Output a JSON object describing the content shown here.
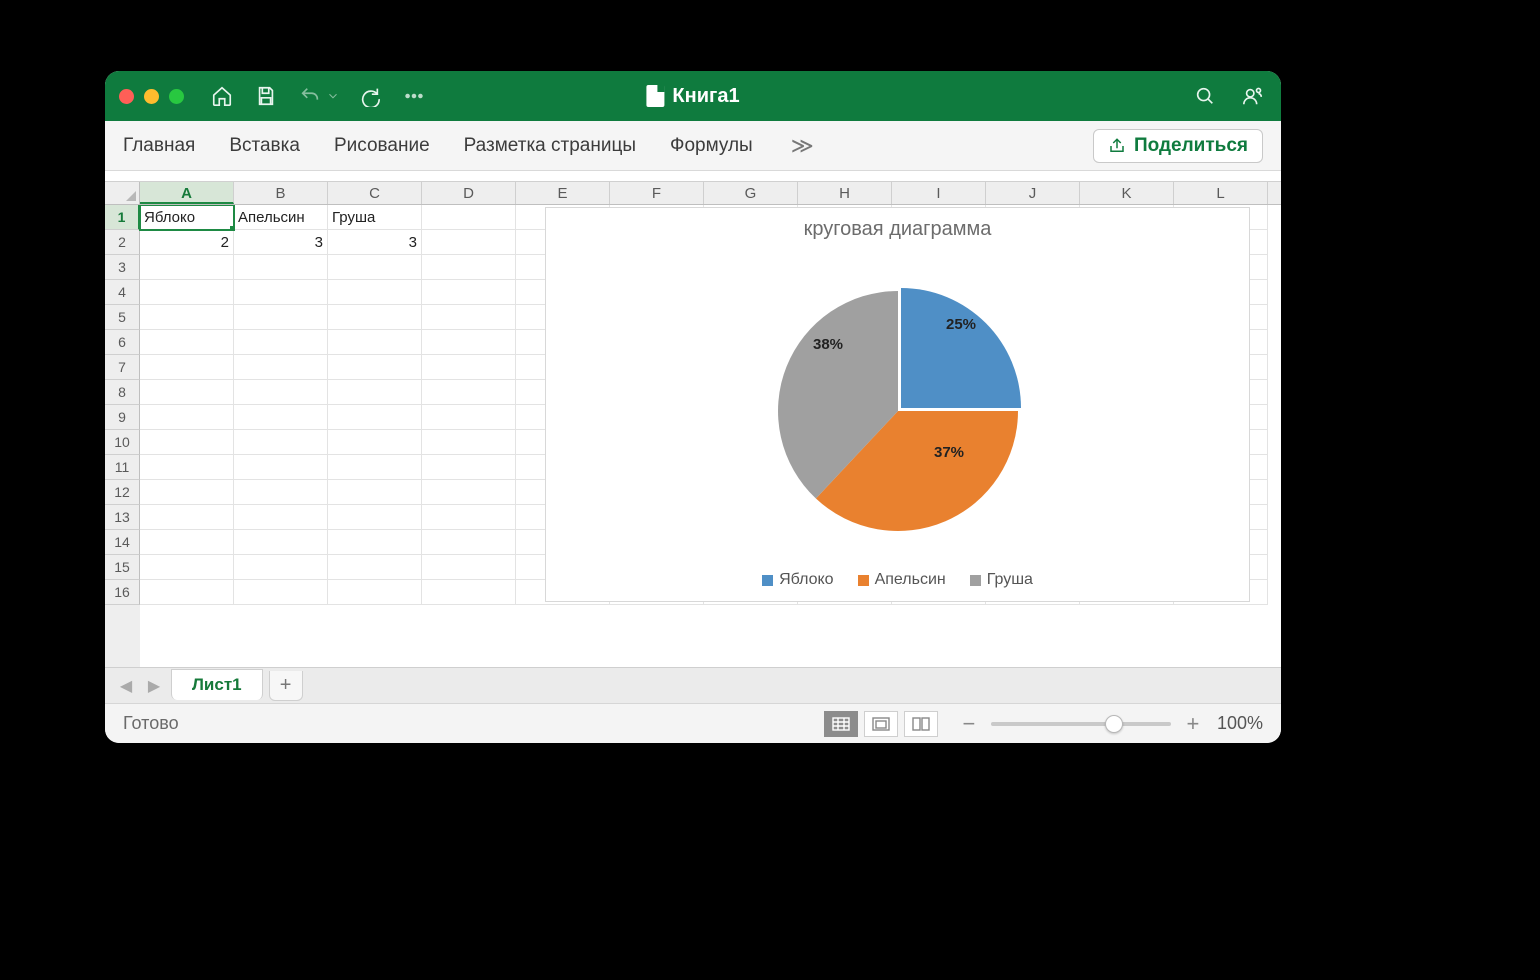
{
  "titlebar": {
    "doc_name": "Книга1"
  },
  "ribbon": {
    "tabs": [
      "Главная",
      "Вставка",
      "Рисование",
      "Разметка страницы",
      "Формулы"
    ],
    "share_label": "Поделиться"
  },
  "columns": [
    "A",
    "B",
    "C",
    "D",
    "E",
    "F",
    "G",
    "H",
    "I",
    "J",
    "K",
    "L"
  ],
  "rows": [
    "1",
    "2",
    "3",
    "4",
    "5",
    "6",
    "7",
    "8",
    "9",
    "10",
    "11",
    "12",
    "13",
    "14",
    "15",
    "16"
  ],
  "active_cell": "A1",
  "data": {
    "A1": "Яблоко",
    "B1": "Апельсин",
    "C1": "Груша",
    "A2": "2",
    "B2": "3",
    "C2": "3"
  },
  "sheet": {
    "name": "Лист1"
  },
  "status": {
    "ready": "Готово",
    "zoom": "100%"
  },
  "chart_data": {
    "type": "pie",
    "title": "круговая диаграмма",
    "series": [
      {
        "name": "Яблоко",
        "value": 2,
        "pct": "25%",
        "color": "#4f8fc6"
      },
      {
        "name": "Апельсин",
        "value": 3,
        "pct": "37%",
        "color": "#e9812f"
      },
      {
        "name": "Груша",
        "value": 3,
        "pct": "38%",
        "color": "#a0a0a0"
      }
    ],
    "legend_position": "bottom"
  }
}
